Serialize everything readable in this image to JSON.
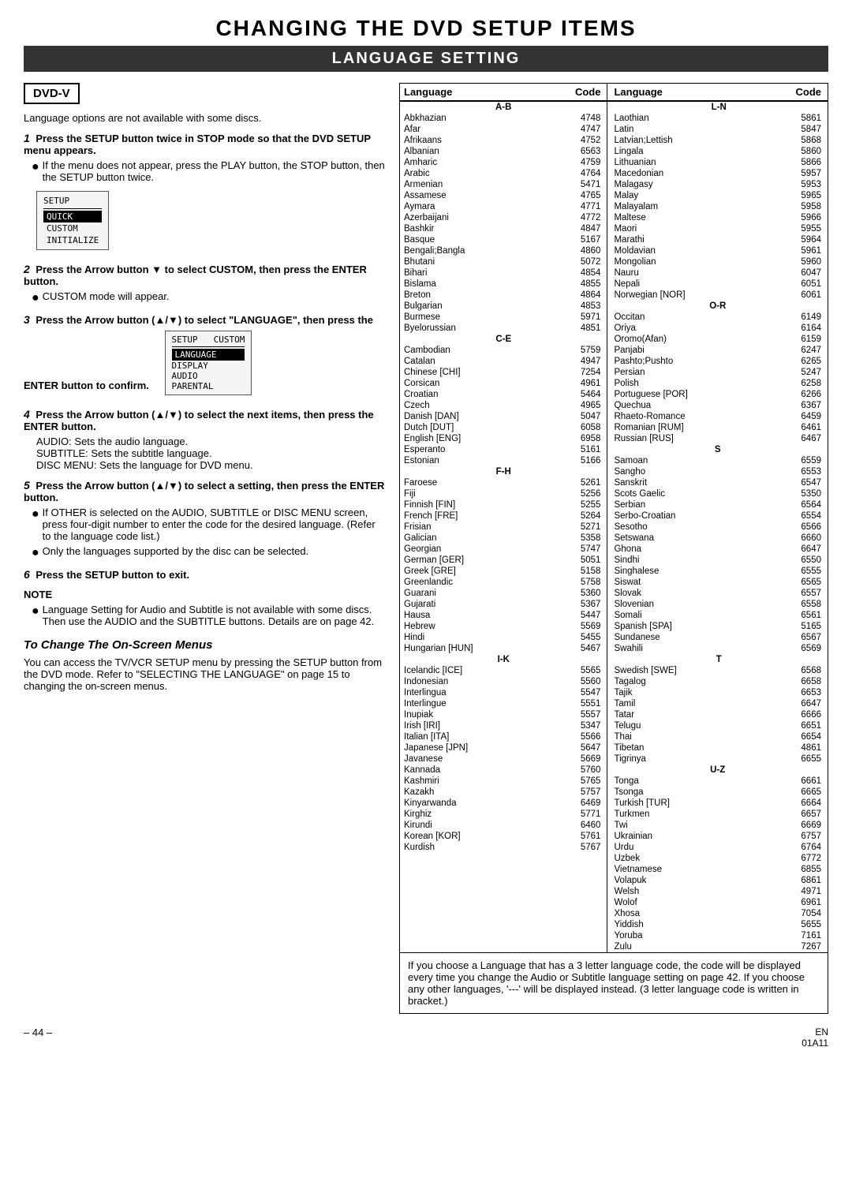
{
  "page": {
    "main_title": "CHANGING THE DVD SETUP ITEMS",
    "section_title": "LANGUAGE SETTING",
    "dvd_badge": "DVD-V",
    "intro_note": "Language options are not available with some discs.",
    "steps": [
      {
        "num": "1",
        "bold": "Press the SETUP button twice in STOP mode so that the DVD SETUP menu appears."
      },
      {
        "num": "2",
        "bold": "Press the Arrow button ▼ to select CUSTOM, then press the ENTER button."
      },
      {
        "num": "3",
        "bold": "Press the Arrow button (▲/▼) to select \"LANGUAGE\", then press the ENTER button to confirm."
      },
      {
        "num": "4",
        "bold": "Press the Arrow button (▲/▼) to select the next items, then press the ENTER button."
      },
      {
        "num": "5",
        "bold": "Press the Arrow button (▲/▼) to select a setting, then press the ENTER button."
      },
      {
        "num": "6",
        "bold": "Press the SETUP button to exit."
      }
    ],
    "bullet1": "If the menu does not appear, press the PLAY button, the STOP button, then the SETUP button twice.",
    "bullet2": "CUSTOM mode will appear.",
    "bullet3a": "If OTHER is selected on the AUDIO, SUBTITLE or DISC MENU screen, press four-digit number to enter the code for the desired language. (Refer to the language code list.)",
    "bullet3b": "Only the languages supported by the disc can be selected.",
    "audio_line": "AUDIO: Sets the audio language.",
    "subtitle_line": "SUBTITLE: Sets the subtitle language.",
    "disc_menu_line": "DISC MENU: Sets the language for DVD menu.",
    "note_label": "NOTE",
    "note_text": "Language Setting for Audio and Subtitle is not available with some discs. Then use the AUDIO and the SUBTITLE buttons. Details are on page 42.",
    "change_title": "To Change The On-Screen Menus",
    "change_text": "You can access the TV/VCR SETUP menu by pressing the SETUP button from the DVD mode. Refer to \"SELECTING THE LANGUAGE\" on page 15 to changing the on-screen menus.",
    "bottom_info": "If you choose a Language that has a 3 letter language code, the code will be displayed every time you change the Audio or Subtitle language setting on page 42. If you choose any other languages, '---' will be displayed instead. (3 letter language code is written in bracket.)",
    "page_num": "– 44 –",
    "footer_en": "EN",
    "footer_code": "01A11"
  },
  "setup_menu1": {
    "title": "SETUP",
    "items": [
      "QUICK",
      "CUSTOM",
      "INITIALIZE"
    ]
  },
  "setup_menu2": {
    "header_left": "SETUP",
    "header_right": "CUSTOM",
    "items": [
      "LANGUAGE",
      "DISPLAY",
      "AUDIO",
      "PARENTAL"
    ]
  },
  "lang_table": {
    "headers": [
      "Language",
      "Code",
      "Language",
      "Code"
    ],
    "section_ab": "A-B",
    "section_ln": "L-N",
    "section_ce": "C-E",
    "section_or": "O-R",
    "section_fh": "F-H",
    "section_s": "S",
    "section_ik": "I-K",
    "section_t": "T",
    "section_uz": "U-Z",
    "left_col": [
      {
        "lang": "Abkhazian",
        "code": "4748"
      },
      {
        "lang": "Afar",
        "code": "4747"
      },
      {
        "lang": "Afrikaans",
        "code": "4752"
      },
      {
        "lang": "Albanian",
        "code": "6563"
      },
      {
        "lang": "Amharic",
        "code": "4759"
      },
      {
        "lang": "Arabic",
        "code": "4764"
      },
      {
        "lang": "Armenian",
        "code": "5471"
      },
      {
        "lang": "Assamese",
        "code": "4765"
      },
      {
        "lang": "Aymara",
        "code": "4771"
      },
      {
        "lang": "Azerbaijani",
        "code": "4772"
      },
      {
        "lang": "Bashkir",
        "code": "4847"
      },
      {
        "lang": "Basque",
        "code": "5167"
      },
      {
        "lang": "Bengali;Bangla",
        "code": "4860"
      },
      {
        "lang": "Bhutani",
        "code": "5072"
      },
      {
        "lang": "Bihari",
        "code": "4854"
      },
      {
        "lang": "Bislama",
        "code": "4855"
      },
      {
        "lang": "Breton",
        "code": "4864"
      },
      {
        "lang": "Bulgarian",
        "code": "4853"
      },
      {
        "lang": "Burmese",
        "code": "5971"
      },
      {
        "lang": "Byelorussian",
        "code": "4851"
      },
      {
        "lang": "Cambodian",
        "code": "5759"
      },
      {
        "lang": "Catalan",
        "code": "4947"
      },
      {
        "lang": "Chinese [CHI]",
        "code": "7254"
      },
      {
        "lang": "Corsican",
        "code": "4961"
      },
      {
        "lang": "Croatian",
        "code": "5464"
      },
      {
        "lang": "Czech",
        "code": "4965"
      },
      {
        "lang": "Danish [DAN]",
        "code": "5047"
      },
      {
        "lang": "Dutch [DUT]",
        "code": "6058"
      },
      {
        "lang": "English [ENG]",
        "code": "6958"
      },
      {
        "lang": "Esperanto",
        "code": "5161"
      },
      {
        "lang": "Estonian",
        "code": "5166"
      },
      {
        "lang": "Faroese",
        "code": "5261"
      },
      {
        "lang": "Fiji",
        "code": "5256"
      },
      {
        "lang": "Finnish [FIN]",
        "code": "5255"
      },
      {
        "lang": "French [FRE]",
        "code": "5264"
      },
      {
        "lang": "Frisian",
        "code": "5271"
      },
      {
        "lang": "Galician",
        "code": "5358"
      },
      {
        "lang": "Georgian",
        "code": "5747"
      },
      {
        "lang": "German [GER]",
        "code": "5051"
      },
      {
        "lang": "Greek [GRE]",
        "code": "5158"
      },
      {
        "lang": "Greenlandic",
        "code": "5758"
      },
      {
        "lang": "Guarani",
        "code": "5360"
      },
      {
        "lang": "Gujarati",
        "code": "5367"
      },
      {
        "lang": "Hausa",
        "code": "5447"
      },
      {
        "lang": "Hebrew",
        "code": "5569"
      },
      {
        "lang": "Hindi",
        "code": "5455"
      },
      {
        "lang": "Hungarian [HUN]",
        "code": "5467"
      },
      {
        "lang": "Icelandic [ICE]",
        "code": "5565"
      },
      {
        "lang": "Indonesian",
        "code": "5560"
      },
      {
        "lang": "Interlingua",
        "code": "5547"
      },
      {
        "lang": "Interlingue",
        "code": "5551"
      },
      {
        "lang": "Inupiak",
        "code": "5557"
      },
      {
        "lang": "Irish [IRI]",
        "code": "5347"
      },
      {
        "lang": "Italian [ITA]",
        "code": "5566"
      },
      {
        "lang": "Japanese [JPN]",
        "code": "5647"
      },
      {
        "lang": "Javanese",
        "code": "5669"
      },
      {
        "lang": "Kannada",
        "code": "5760"
      },
      {
        "lang": "Kashmiri",
        "code": "5765"
      },
      {
        "lang": "Kazakh",
        "code": "5757"
      },
      {
        "lang": "Kinyarwanda",
        "code": "6469"
      },
      {
        "lang": "Kirghiz",
        "code": "5771"
      },
      {
        "lang": "Kirundi",
        "code": "6460"
      },
      {
        "lang": "Korean [KOR]",
        "code": "5761"
      },
      {
        "lang": "Kurdish",
        "code": "5767"
      }
    ],
    "right_col": [
      {
        "lang": "Laothian",
        "code": "5861"
      },
      {
        "lang": "Latin",
        "code": "5847"
      },
      {
        "lang": "Latvian;Lettish",
        "code": "5868"
      },
      {
        "lang": "Lingala",
        "code": "5860"
      },
      {
        "lang": "Lithuanian",
        "code": "5866"
      },
      {
        "lang": "Macedonian",
        "code": "5957"
      },
      {
        "lang": "Malagasy",
        "code": "5953"
      },
      {
        "lang": "Malay",
        "code": "5965"
      },
      {
        "lang": "Malayalam",
        "code": "5958"
      },
      {
        "lang": "Maltese",
        "code": "5966"
      },
      {
        "lang": "Maori",
        "code": "5955"
      },
      {
        "lang": "Marathi",
        "code": "5964"
      },
      {
        "lang": "Moldavian",
        "code": "5961"
      },
      {
        "lang": "Mongolian",
        "code": "5960"
      },
      {
        "lang": "Nauru",
        "code": "6047"
      },
      {
        "lang": "Nepali",
        "code": "6051"
      },
      {
        "lang": "Norwegian [NOR]",
        "code": "6061"
      },
      {
        "lang": "Occitan",
        "code": "6149"
      },
      {
        "lang": "Oriya",
        "code": "6164"
      },
      {
        "lang": "Oromo(Afan)",
        "code": "6159"
      },
      {
        "lang": "Panjabi",
        "code": "6247"
      },
      {
        "lang": "Pashto;Pushto",
        "code": "6265"
      },
      {
        "lang": "Persian",
        "code": "5247"
      },
      {
        "lang": "Polish",
        "code": "6258"
      },
      {
        "lang": "Portuguese [POR]",
        "code": "6266"
      },
      {
        "lang": "Quechua",
        "code": "6367"
      },
      {
        "lang": "Rhaeto-Romance",
        "code": "6459"
      },
      {
        "lang": "Romanian [RUM]",
        "code": "6461"
      },
      {
        "lang": "Russian [RUS]",
        "code": "6467"
      },
      {
        "lang": "Samoan",
        "code": "6559"
      },
      {
        "lang": "Sangho",
        "code": "6553"
      },
      {
        "lang": "Sanskrit",
        "code": "6547"
      },
      {
        "lang": "Scots Gaelic",
        "code": "5350"
      },
      {
        "lang": "Serbian",
        "code": "6564"
      },
      {
        "lang": "Serbo-Croatian",
        "code": "6554"
      },
      {
        "lang": "Sesotho",
        "code": "6566"
      },
      {
        "lang": "Setswana",
        "code": "6660"
      },
      {
        "lang": "Ghona",
        "code": "6647"
      },
      {
        "lang": "Sindhi",
        "code": "6550"
      },
      {
        "lang": "Singhalese",
        "code": "6555"
      },
      {
        "lang": "Siswat",
        "code": "6565"
      },
      {
        "lang": "Slovak",
        "code": "6557"
      },
      {
        "lang": "Slovenian",
        "code": "6558"
      },
      {
        "lang": "Somali",
        "code": "6561"
      },
      {
        "lang": "Spanish [SPA]",
        "code": "5165"
      },
      {
        "lang": "Sundanese",
        "code": "6567"
      },
      {
        "lang": "Swahili",
        "code": "6569"
      },
      {
        "lang": "Swedish [SWE]",
        "code": "6568"
      },
      {
        "lang": "Tagalog",
        "code": "6658"
      },
      {
        "lang": "Tajik",
        "code": "6653"
      },
      {
        "lang": "Tamil",
        "code": "6647"
      },
      {
        "lang": "Tatar",
        "code": "6666"
      },
      {
        "lang": "Telugu",
        "code": "6651"
      },
      {
        "lang": "Thai",
        "code": "6654"
      },
      {
        "lang": "Tibetan",
        "code": "4861"
      },
      {
        "lang": "Tigrinya",
        "code": "6655"
      },
      {
        "lang": "Tonga",
        "code": "6661"
      },
      {
        "lang": "Tsonga",
        "code": "6665"
      },
      {
        "lang": "Turkish [TUR]",
        "code": "6664"
      },
      {
        "lang": "Turkmen",
        "code": "6657"
      },
      {
        "lang": "Twi",
        "code": "6669"
      },
      {
        "lang": "Ukrainian",
        "code": "6757"
      },
      {
        "lang": "Urdu",
        "code": "6764"
      },
      {
        "lang": "Uzbek",
        "code": "6772"
      },
      {
        "lang": "Vietnamese",
        "code": "6855"
      },
      {
        "lang": "Volapuk",
        "code": "6861"
      },
      {
        "lang": "Welsh",
        "code": "4971"
      },
      {
        "lang": "Wolof",
        "code": "6961"
      },
      {
        "lang": "Xhosa",
        "code": "7054"
      },
      {
        "lang": "Yiddish",
        "code": "5655"
      },
      {
        "lang": "Yoruba",
        "code": "7161"
      },
      {
        "lang": "Zulu",
        "code": "7267"
      }
    ]
  }
}
